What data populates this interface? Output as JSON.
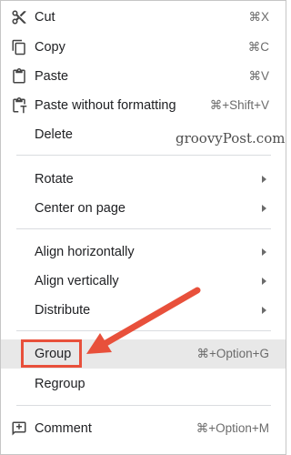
{
  "menu": {
    "items": [
      {
        "label": "Cut",
        "shortcut": "⌘X",
        "icon": "scissors-icon"
      },
      {
        "label": "Copy",
        "shortcut": "⌘C",
        "icon": "copy-icon"
      },
      {
        "label": "Paste",
        "shortcut": "⌘V",
        "icon": "clipboard-icon"
      },
      {
        "label": "Paste without formatting",
        "shortcut": "⌘+Shift+V",
        "icon": "clipboard-plain-icon"
      },
      {
        "label": "Delete"
      },
      {
        "label": "Rotate",
        "submenu": true
      },
      {
        "label": "Center on page",
        "submenu": true
      },
      {
        "label": "Align horizontally",
        "submenu": true
      },
      {
        "label": "Align vertically",
        "submenu": true
      },
      {
        "label": "Distribute",
        "submenu": true
      },
      {
        "label": "Group",
        "shortcut": "⌘+Option+G",
        "highlighted": true
      },
      {
        "label": "Regroup"
      },
      {
        "label": "Comment",
        "shortcut": "⌘+Option+M",
        "icon": "add-comment-icon"
      }
    ]
  },
  "watermark": "groovyPost.com",
  "colors": {
    "highlight": "#e8e8e8",
    "annotation": "#e8503b"
  }
}
